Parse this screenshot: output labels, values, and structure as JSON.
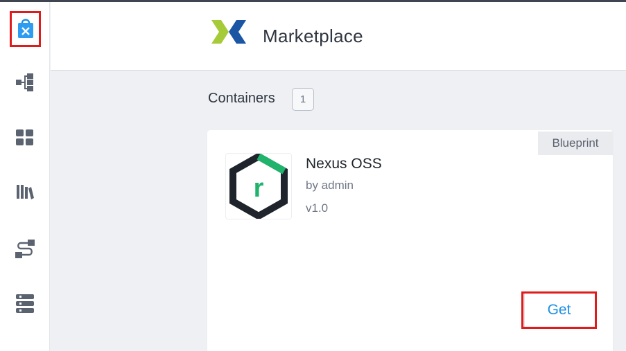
{
  "header": {
    "title": "Marketplace"
  },
  "sidebar": {
    "items": [
      {
        "icon": "marketplace-bag-icon"
      },
      {
        "icon": "blueprint-tree-icon"
      },
      {
        "icon": "apps-grid-icon"
      },
      {
        "icon": "library-books-icon"
      },
      {
        "icon": "runbook-path-icon"
      },
      {
        "icon": "endpoints-list-icon"
      }
    ]
  },
  "main": {
    "section_title": "Containers",
    "count": "1"
  },
  "card": {
    "badge": "Blueprint",
    "name": "Nexus OSS",
    "author": "by admin",
    "version": "v1.0",
    "get_label": "Get"
  },
  "colors": {
    "accent_blue": "#1b8fe6",
    "highlight_red": "#e01b1b",
    "logo_green": "#a6cb38",
    "logo_blue": "#1a56a4",
    "nexus_green": "#1fb36b"
  }
}
